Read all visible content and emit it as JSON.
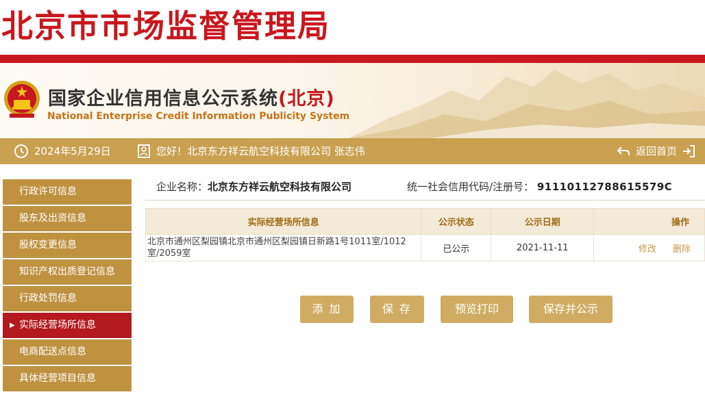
{
  "header": {
    "bureau_title": "北京市市场监督管理局",
    "system_title_cn": "国家企业信用信息公示系统",
    "system_title_region": "(北京)",
    "system_title_en": "National Enterprise Credit Information Publicity System"
  },
  "status_bar": {
    "date": "2024年5月29日",
    "greeting": "您好！北京东方祥云航空科技有限公司 张志伟",
    "home_label": "返回首页"
  },
  "sidebar": {
    "items": [
      {
        "label": "行政许可信息"
      },
      {
        "label": "股东及出资信息"
      },
      {
        "label": "股权变更信息"
      },
      {
        "label": "知识产权出质登记信息"
      },
      {
        "label": "行政处罚信息"
      },
      {
        "label": "实际经营场所信息",
        "active": true
      },
      {
        "label": "电商配送点信息"
      },
      {
        "label": "具体经营项目信息"
      }
    ]
  },
  "company": {
    "name_label": "企业名称：",
    "name": "北京东方祥云航空科技有限公司",
    "credit_label": "统一社会信用代码/注册号：",
    "credit_code": "91110112788615579C"
  },
  "table": {
    "headers": [
      "实际经营场所信息",
      "公示状态",
      "公示日期",
      "操作"
    ],
    "rows": [
      {
        "address": "北京市通州区梨园镇北京市通州区梨园镇日新路1号1011室/1012室/2059室",
        "status": "已公示",
        "date": "2021-11-11",
        "edit_label": "修改",
        "delete_label": "删除"
      }
    ]
  },
  "buttons": {
    "add": "添 加",
    "save": "保 存",
    "preview_print": "预览打印",
    "save_publish": "保存并公示"
  },
  "colors": {
    "brand_red": "#c8171e",
    "gold": "#c9a04f",
    "sidebar_gold": "#bf9240",
    "active_red": "#b3191e"
  }
}
